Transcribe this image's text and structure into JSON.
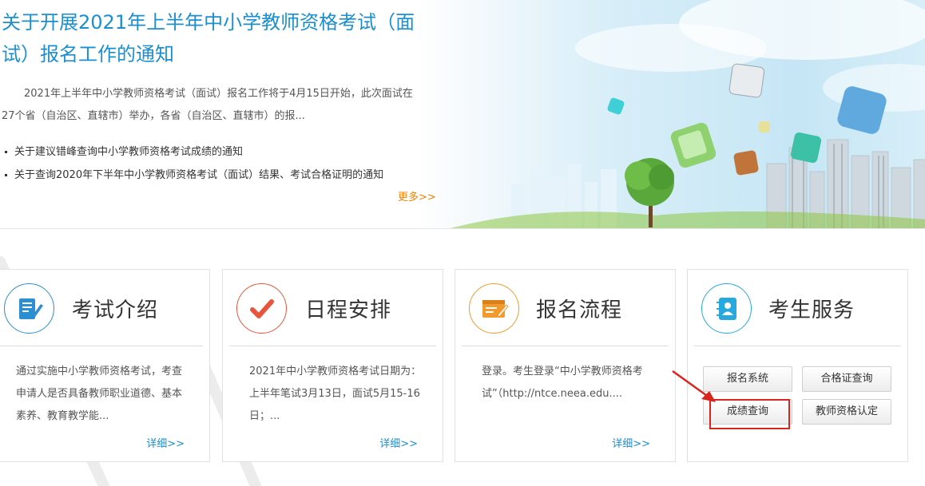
{
  "banner": {
    "title": "关于开展2021年上半年中小学教师资格考试（面试）报名工作的通知",
    "summary": "2021年上半年中小学教师资格考试（面试）报名工作将于4月15日开始，此次面试在27个省（自治区、直辖市）举办，各省（自治区、直辖市）的报...",
    "news_items": [
      "关于建议错峰查询中小学教师资格考试成绩的通知",
      "关于查询2020年下半年中小学教师资格考试（面试）结果、考试合格证明的通知"
    ],
    "more_label": "更多>>"
  },
  "cards": [
    {
      "title": "考试介绍",
      "icon": "document-pen-icon",
      "color": "#2b8fd2",
      "text": "通过实施中小学教师资格考试，考查申请人是否具备教师职业道德、基本素养、教育教学能...",
      "detail": "详细>>"
    },
    {
      "title": "日程安排",
      "icon": "checkmark-icon",
      "color": "#e8553c",
      "text": "2021年中小学教师资格考试日期为：上半年笔试3月13日，面试5月15-16日；...",
      "detail": "详细>>"
    },
    {
      "title": "报名流程",
      "icon": "form-pen-icon",
      "color": "#f29a2e",
      "text": "登录。考生登录“中小学教师资格考试”（http://ntce.neea.edu....",
      "detail": "详细>>"
    },
    {
      "title": "考生服务",
      "icon": "contact-book-icon",
      "color": "#27a9df",
      "buttons": [
        "报名系统",
        "合格证查询",
        "成绩查询",
        "教师资格认定"
      ]
    }
  ],
  "annotation": {
    "highlight_color": "#d9251d"
  }
}
